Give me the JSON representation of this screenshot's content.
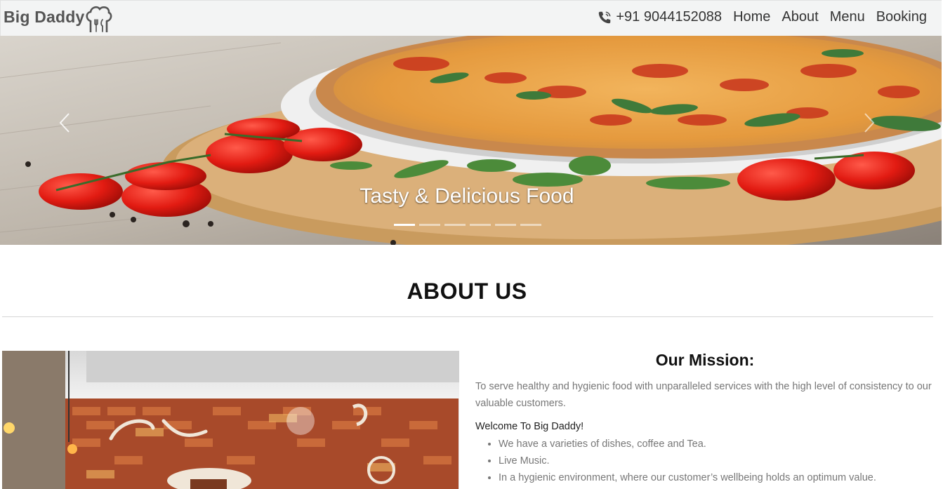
{
  "navbar": {
    "brand": "Big Daddy",
    "phone": "+91 9044152088",
    "links": [
      "Home",
      "About",
      "Menu",
      "Booking"
    ]
  },
  "hero": {
    "caption": "Tasty & Delicious Food",
    "slide_count": 6,
    "active_slide": 1
  },
  "about": {
    "title": "ABOUT US",
    "mission_title": "Our Mission:",
    "mission_text": "To serve healthy and hygienic food with unparalleled services with the high level of consistency to our valuable customers.",
    "welcome": "Welcome To Big Daddy!",
    "features": [
      "We have a varieties of dishes, coffee and Tea.",
      "Live Music.",
      "In a hygienic environment, where our customer’s wellbeing holds an optimum value."
    ]
  },
  "icons": {
    "brand_logo": "chef-hat-cutlery-icon",
    "phone": "phone-icon",
    "prev": "chevron-left-icon",
    "next": "chevron-right-icon"
  }
}
